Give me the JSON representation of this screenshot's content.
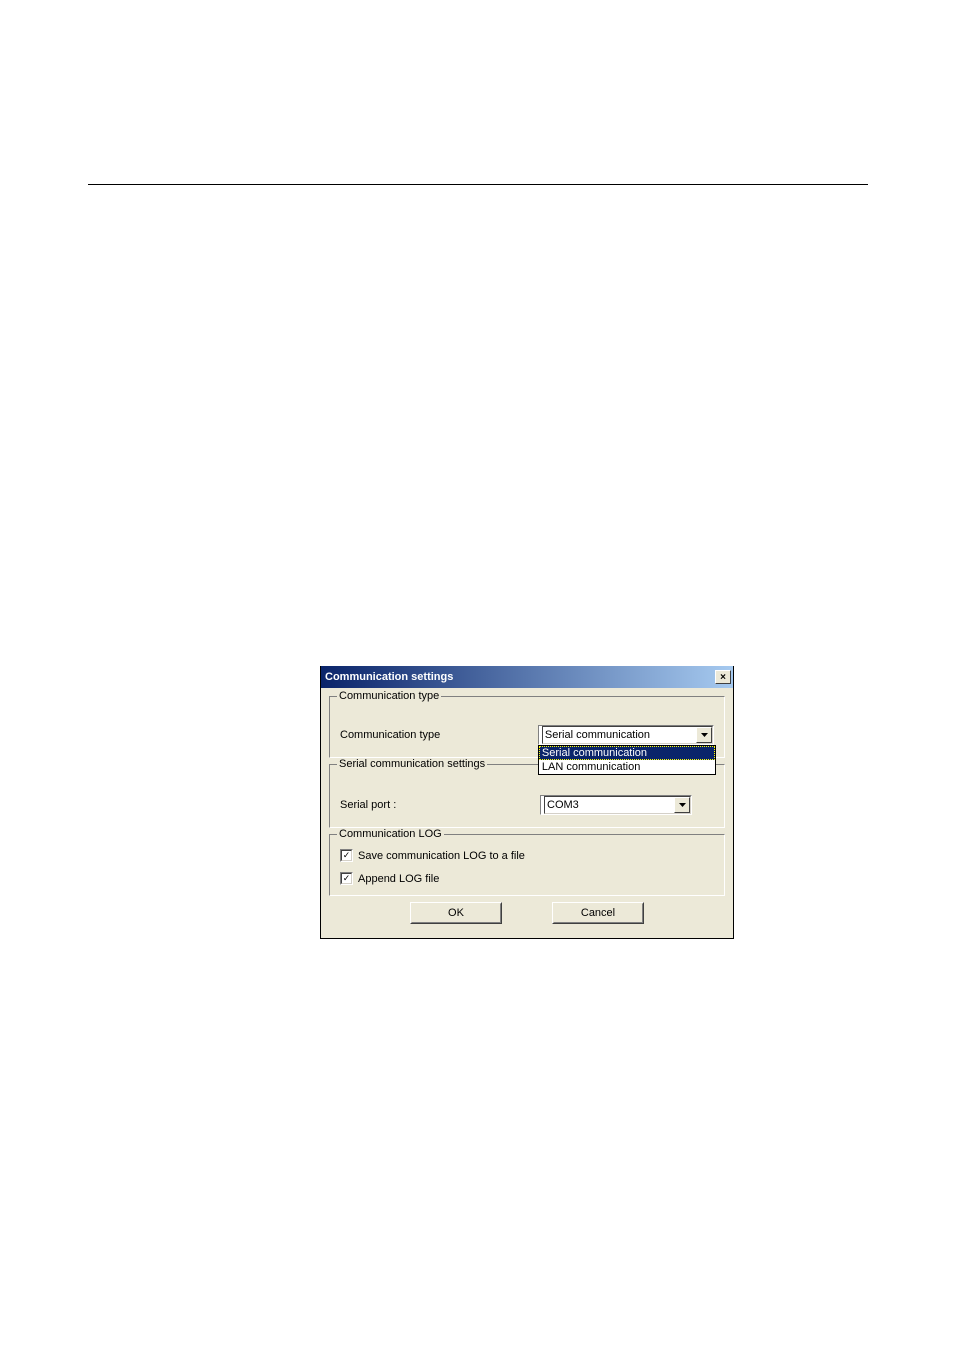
{
  "dialog": {
    "title": "Communication settings",
    "close_label": "×"
  },
  "group_comm_type": {
    "title": "Communication type",
    "label": "Communication type",
    "value": "Serial communication",
    "options": {
      "serial": "Serial communication",
      "lan": "LAN communication"
    }
  },
  "group_serial": {
    "title": "Serial communication settings",
    "label": "Serial port :",
    "value": "COM3"
  },
  "group_log": {
    "title": "Communication LOG",
    "save_label": "Save communication LOG to a file",
    "append_label": "Append LOG file"
  },
  "buttons": {
    "ok": "OK",
    "cancel": "Cancel"
  }
}
